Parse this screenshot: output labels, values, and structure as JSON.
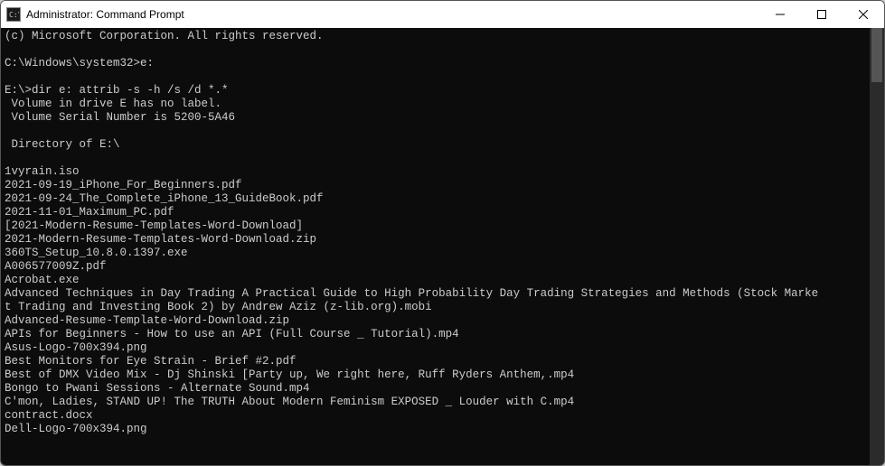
{
  "window": {
    "title": "Administrator: Command Prompt"
  },
  "terminal": {
    "lines": [
      "(c) Microsoft Corporation. All rights reserved.",
      "",
      "C:\\Windows\\system32>e:",
      "",
      "E:\\>dir e: attrib -s -h /s /d *.*",
      " Volume in drive E has no label.",
      " Volume Serial Number is 5200-5A46",
      "",
      " Directory of E:\\",
      "",
      "1vyrain.iso",
      "2021-09-19_iPhone_For_Beginners.pdf",
      "2021-09-24_The_Complete_iPhone_13_GuideBook.pdf",
      "2021-11-01_Maximum_PC.pdf",
      "[2021-Modern-Resume-Templates-Word-Download]",
      "2021-Modern-Resume-Templates-Word-Download.zip",
      "360TS_Setup_10.8.0.1397.exe",
      "A006577009Z.pdf",
      "Acrobat.exe",
      "Advanced Techniques in Day Trading A Practical Guide to High Probability Day Trading Strategies and Methods (Stock Marke",
      "t Trading and Investing Book 2) by Andrew Aziz (z-lib.org).mobi",
      "Advanced-Resume-Template-Word-Download.zip",
      "APIs for Beginners - How to use an API (Full Course _ Tutorial).mp4",
      "Asus-Logo-700x394.png",
      "Best Monitors for Eye Strain - Brief #2.pdf",
      "Best of DMX Video Mix - Dj Shinski [Party up, We right here, Ruff Ryders Anthem,.mp4",
      "Bongo to Pwani Sessions - Alternate Sound.mp4",
      "C'mon, Ladies, STAND UP! The TRUTH About Modern Feminism EXPOSED _ Louder with C.mp4",
      "contract.docx",
      "Dell-Logo-700x394.png"
    ]
  }
}
